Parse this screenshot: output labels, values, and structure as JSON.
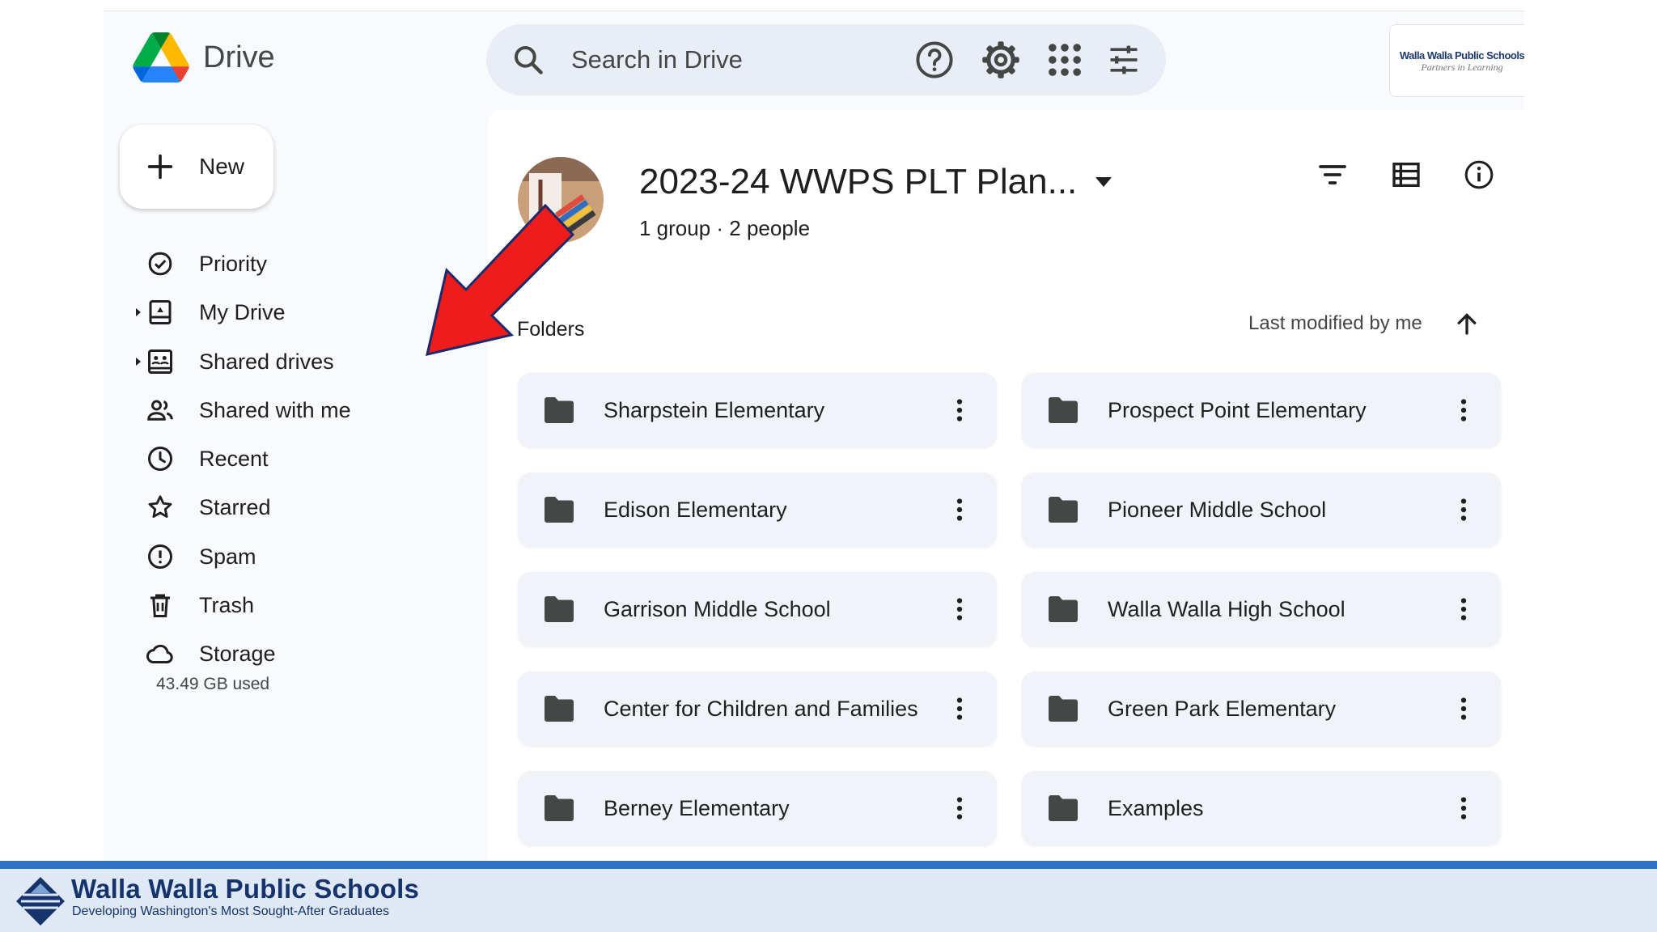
{
  "app": {
    "name": "Drive",
    "logo_icon": "google-drive-logo"
  },
  "search": {
    "placeholder": "Search in Drive",
    "icon": "search-icon",
    "options_icon": "tune-icon"
  },
  "header": {
    "icons": [
      "help-icon",
      "settings-icon",
      "apps-grid-icon"
    ],
    "account_logo_line1": "Walla Walla Public Schools",
    "account_logo_line2": "Partners in Learning"
  },
  "sidebar": {
    "new_label": "New",
    "items": [
      {
        "label": "Priority",
        "icon": "priority-check-icon",
        "expandable": false
      },
      {
        "label": "My Drive",
        "icon": "my-drive-icon",
        "expandable": true
      },
      {
        "label": "Shared drives",
        "icon": "shared-drives-icon",
        "expandable": true
      },
      {
        "label": "Shared with me",
        "icon": "people-icon",
        "expandable": false
      },
      {
        "label": "Recent",
        "icon": "clock-icon",
        "expandable": false
      },
      {
        "label": "Starred",
        "icon": "star-icon",
        "expandable": false
      },
      {
        "label": "Spam",
        "icon": "spam-icon",
        "expandable": false
      },
      {
        "label": "Trash",
        "icon": "trash-icon",
        "expandable": false
      },
      {
        "label": "Storage",
        "icon": "cloud-icon",
        "expandable": false
      }
    ],
    "storage_used": "43.49 GB used"
  },
  "shared_drive": {
    "title": "2023-24 WWPS PLT Plan...",
    "members": "1 group · 2 people",
    "actions": [
      "filter-icon",
      "list-view-icon",
      "info-icon"
    ]
  },
  "folders": {
    "heading": "Folders",
    "sort_label": "Last modified by me",
    "sort_direction": "ascending",
    "items": [
      {
        "name": "Sharpstein Elementary"
      },
      {
        "name": "Prospect Point Elementary"
      },
      {
        "name": "Edison Elementary"
      },
      {
        "name": "Pioneer Middle School"
      },
      {
        "name": "Garrison Middle School"
      },
      {
        "name": "Walla Walla High School"
      },
      {
        "name": "Center for Children and Families"
      },
      {
        "name": "Green Park Elementary"
      },
      {
        "name": "Berney Elementary"
      },
      {
        "name": "Examples"
      }
    ]
  },
  "annotation": {
    "arrow_color": "#ee1c1c",
    "points_to": "Shared drives"
  },
  "footer": {
    "org": "Walla Walla Public Schools",
    "tagline": "Developing Washington's Most Sought-After Graduates",
    "brand_color": "#16346b",
    "bar_color": "#2f73c4"
  }
}
